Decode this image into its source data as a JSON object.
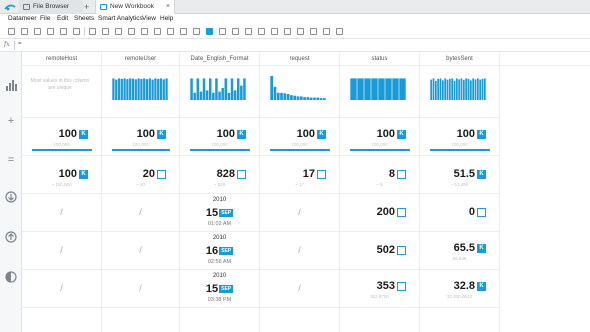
{
  "tabs": [
    {
      "label": "File Browser"
    },
    {
      "label": "New Workbook"
    }
  ],
  "menu": [
    "Datameer",
    "File",
    "Edit",
    "Sheets",
    "Smart Analytics",
    "View",
    "Help"
  ],
  "formula_value": "=",
  "formula_symbol": "fx",
  "columns": [
    {
      "header": "remoteHost",
      "hist_note": "Most values in this column are unique"
    },
    {
      "header": "remoteUser"
    },
    {
      "header": "Date_English_Format"
    },
    {
      "header": "request"
    },
    {
      "header": "status"
    },
    {
      "header": "bytesSent"
    }
  ],
  "count_row": [
    {
      "value": "100",
      "unit": "K",
      "sub": "100,000"
    },
    {
      "value": "100",
      "unit": "K",
      "sub": "100,000"
    },
    {
      "value": "100",
      "unit": "K",
      "sub": "100,000"
    },
    {
      "value": "100",
      "unit": "K",
      "sub": "100,000"
    },
    {
      "value": "100",
      "unit": "K",
      "sub": "100,000"
    },
    {
      "value": "100",
      "unit": "K",
      "sub": "100,000"
    }
  ],
  "distinct_row": [
    {
      "value": "100",
      "unit": "K",
      "sub": "~ 100,000"
    },
    {
      "value": "20",
      "sub": "~ 20"
    },
    {
      "value": "828",
      "sub": "~ 828"
    },
    {
      "value": "17",
      "sub": "~ 17"
    },
    {
      "value": "8",
      "sub": "~ 8"
    },
    {
      "value": "51.5",
      "unit": "K",
      "sub": "~ 51,490"
    }
  ],
  "min_row": {
    "remoteHost": "/",
    "remoteUser": "/",
    "date": {
      "year": "2010",
      "day": "15",
      "month": "SEP",
      "time": "01:02 AM"
    },
    "request": "/",
    "status": {
      "value": "200"
    },
    "bytesSent": {
      "value": "0"
    }
  },
  "max_row": {
    "remoteHost": "/",
    "remoteUser": "/",
    "date": {
      "year": "2010",
      "day": "16",
      "month": "SEP",
      "time": "02:56 AM"
    },
    "request": "/",
    "status": {
      "value": "502"
    },
    "bytesSent": {
      "value": "65.5",
      "unit": "K",
      "sub": "65,536"
    }
  },
  "mean_row": {
    "remoteHost": "/",
    "remoteUser": "/",
    "date": {
      "year": "2010",
      "day": "15",
      "month": "SEP",
      "time": "03:38 PM"
    },
    "request": "/",
    "status": {
      "value": "353",
      "sub": "352.9700"
    },
    "bytesSent": {
      "value": "32.8",
      "unit": "K",
      "sub": "32,830.0633"
    }
  },
  "gutter_icons": [
    "histogram-icon",
    "count-icon",
    "distinct-icon",
    "min-icon",
    "max-icon",
    "mean-icon"
  ],
  "accent_color": "#1a9ad6",
  "histograms": {
    "remoteUser": [
      0.9,
      0.85,
      0.9,
      0.88,
      0.9,
      0.87,
      0.9,
      0.89,
      0.86,
      0.9,
      0.88,
      0.9,
      0.87,
      0.9,
      0.85,
      0.9,
      0.88,
      0.9,
      0.86,
      0.9
    ],
    "date": [
      0.9,
      0.3,
      0.9,
      0.35,
      0.9,
      0.4,
      0.9,
      0.3,
      0.9,
      0.35,
      0.5,
      0.9,
      0.3,
      0.9,
      0.4,
      0.9,
      0.6,
      0.9
    ],
    "request": [
      1.0,
      0.55,
      0.3,
      0.3,
      0.28,
      0.25,
      0.2,
      0.18,
      0.15,
      0.15,
      0.12,
      0.12,
      0.1,
      0.1,
      0.1,
      0.08,
      0.08
    ],
    "status": [
      0.9,
      0.9,
      0.9,
      0.9,
      0.9,
      0.9,
      0.9,
      0.9
    ],
    "bytesSent": [
      0.85,
      0.9,
      0.8,
      0.88,
      0.9,
      0.82,
      0.9,
      0.85,
      0.88,
      0.9,
      0.8,
      0.9,
      0.86,
      0.9,
      0.84,
      0.9,
      0.88,
      0.82,
      0.9,
      0.86,
      0.9,
      0.85,
      0.88,
      0.9
    ]
  }
}
